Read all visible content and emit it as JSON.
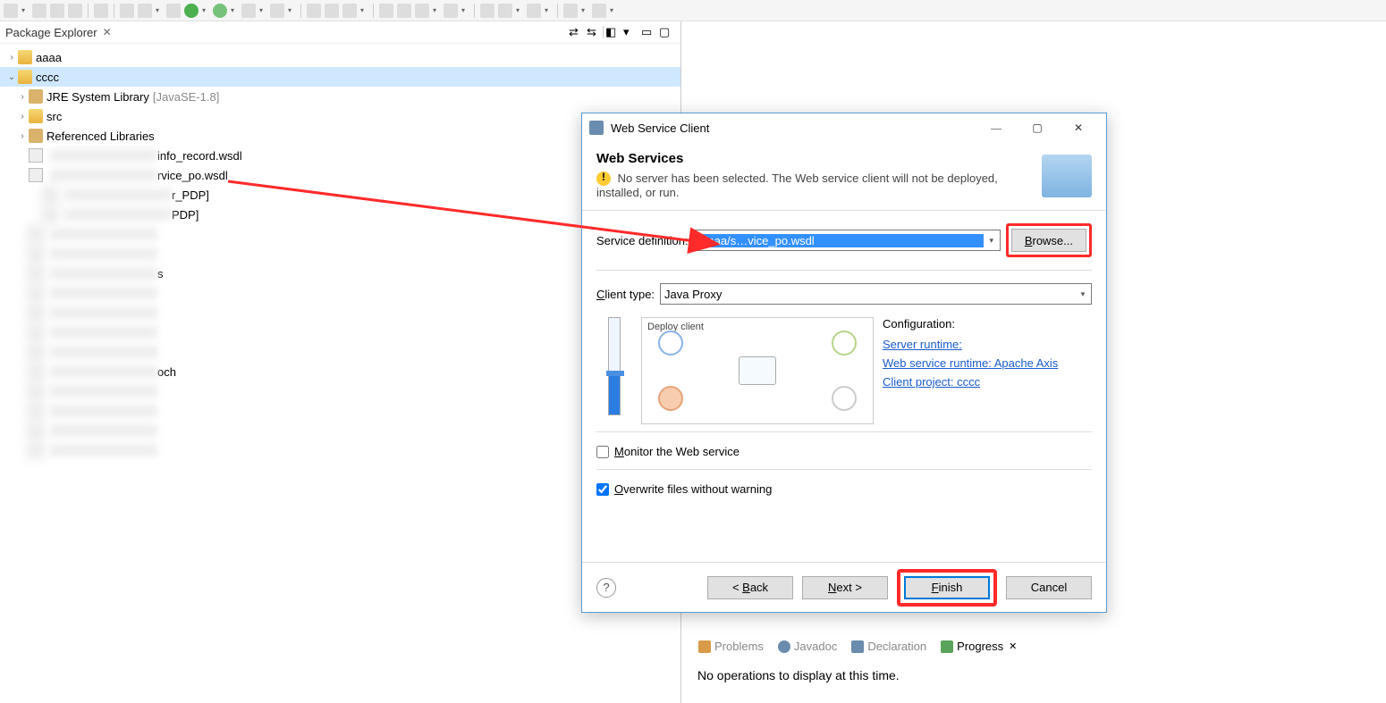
{
  "explorer": {
    "title": "Package Explorer",
    "projects": [
      {
        "name": "aaaa",
        "expanded": false
      },
      {
        "name": "cccc",
        "expanded": true,
        "selected": true,
        "children": [
          {
            "name": "JRE System Library",
            "suffix": "[JavaSE-1.8]",
            "icon": "jar"
          },
          {
            "name": "src",
            "icon": "folder"
          },
          {
            "name": "Referenced Libraries",
            "icon": "jar"
          },
          {
            "name": "info_record.wsdl",
            "icon": "file",
            "blurred_prefix": true
          },
          {
            "name": "rvice_po.wsdl",
            "icon": "file",
            "blurred_prefix": true
          }
        ]
      }
    ],
    "obscured_suffixes": [
      "r_PDP]",
      "PDP]",
      "",
      "",
      "s",
      "",
      "",
      "",
      "",
      "och",
      "",
      "",
      "",
      ""
    ]
  },
  "dialog": {
    "window_title": "Web Service Client",
    "heading": "Web Services",
    "warning": "No server has been selected. The Web service client will not be deployed, installed, or run.",
    "service_def_label": "Service definition:",
    "service_def_value": "/aaaa/s…vice_po.wsdl",
    "browse_label": "Browse...",
    "client_type_label": "Client type:",
    "client_type_value": "Java Proxy",
    "diagram_caption": "Deploy client",
    "config_header": "Configuration:",
    "links": {
      "server_runtime": "Server runtime: ",
      "ws_runtime": "Web service runtime: Apache Axis",
      "client_project": "Client project: cccc"
    },
    "monitor_label": "Monitor the Web service",
    "monitor_checked": false,
    "overwrite_label": "Overwrite files without warning",
    "overwrite_checked": true,
    "buttons": {
      "back": "< Back",
      "next": "Next >",
      "finish": "Finish",
      "cancel": "Cancel"
    }
  },
  "bottom_tabs": {
    "items": [
      {
        "label": "Problems",
        "color": "#d18b3a"
      },
      {
        "label": "Javadoc",
        "color": "#6a8caf"
      },
      {
        "label": "Declaration",
        "color": "#6a8caf"
      },
      {
        "label": "Progress",
        "color": "#5aa35a",
        "active": true
      }
    ],
    "message": "No operations to display at this time."
  }
}
